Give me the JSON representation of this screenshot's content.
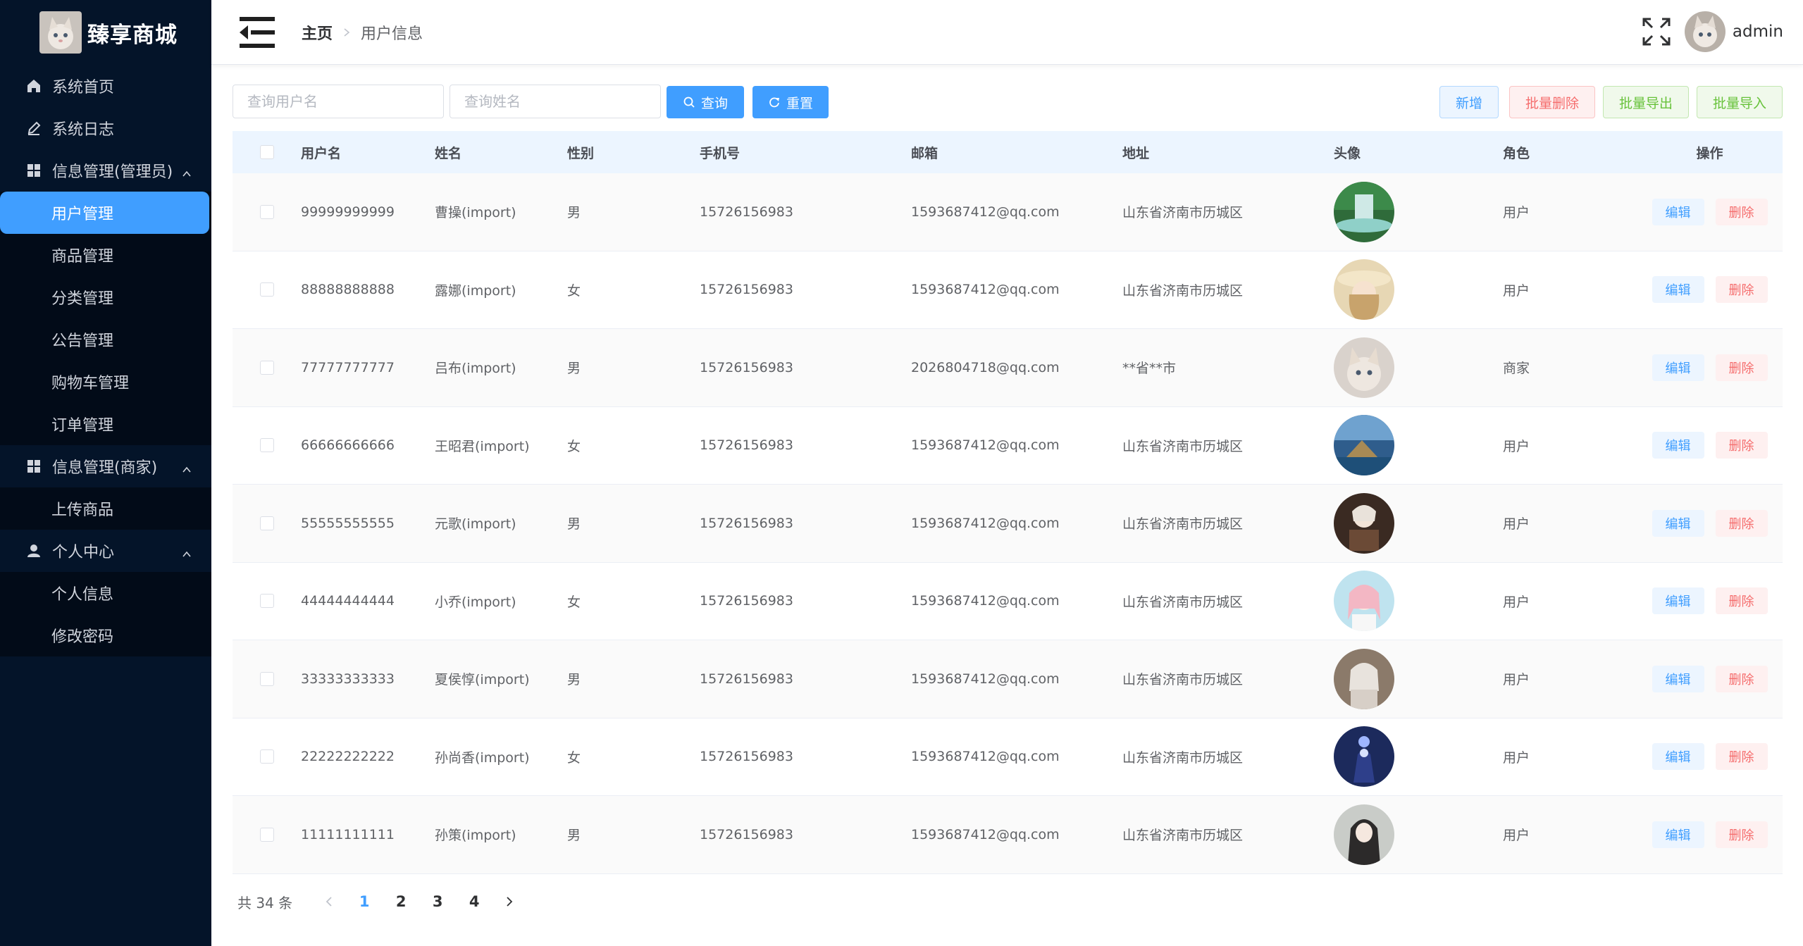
{
  "app": {
    "title": "臻享商城"
  },
  "sidebar": {
    "items": [
      {
        "label": "系统首页"
      },
      {
        "label": "系统日志"
      }
    ],
    "groups": [
      {
        "label": "信息管理(管理员)",
        "children": [
          "用户管理",
          "商品管理",
          "分类管理",
          "公告管理",
          "购物车管理",
          "订单管理"
        ]
      },
      {
        "label": "信息管理(商家)",
        "children": [
          "上传商品"
        ]
      },
      {
        "label": "个人中心",
        "children": [
          "个人信息",
          "修改密码"
        ]
      }
    ],
    "active": "用户管理"
  },
  "header": {
    "breadcrumb": {
      "home": "主页",
      "current": "用户信息"
    },
    "username": "admin"
  },
  "toolbar": {
    "username_placeholder": "查询用户名",
    "name_placeholder": "查询姓名",
    "search_label": "查询",
    "reset_label": "重置",
    "add_label": "新增",
    "batch_delete_label": "批量删除",
    "batch_export_label": "批量导出",
    "batch_import_label": "批量导入"
  },
  "table": {
    "columns": [
      "用户名",
      "姓名",
      "性别",
      "手机号",
      "邮箱",
      "地址",
      "头像",
      "角色",
      "操作"
    ],
    "edit_label": "编辑",
    "delete_label": "删除",
    "rows": [
      {
        "username": "99999999999",
        "name": "曹操(import)",
        "sex": "男",
        "phone": "15726156983",
        "email": "1593687412@qq.com",
        "address": "山东省济南市历城区",
        "role": "用户",
        "avatar": "waterfall"
      },
      {
        "username": "88888888888",
        "name": "露娜(import)",
        "sex": "女",
        "phone": "15726156983",
        "email": "1593687412@qq.com",
        "address": "山东省济南市历城区",
        "role": "用户",
        "avatar": "girl-hat"
      },
      {
        "username": "77777777777",
        "name": "吕布(import)",
        "sex": "男",
        "phone": "15726156983",
        "email": "2026804718@qq.com",
        "address": "**省**市",
        "role": "商家",
        "avatar": "cat"
      },
      {
        "username": "66666666666",
        "name": "王昭君(import)",
        "sex": "女",
        "phone": "15726156983",
        "email": "1593687412@qq.com",
        "address": "山东省济南市历城区",
        "role": "用户",
        "avatar": "lake-island"
      },
      {
        "username": "55555555555",
        "name": "元歌(import)",
        "sex": "男",
        "phone": "15726156983",
        "email": "1593687412@qq.com",
        "address": "山东省济南市历城区",
        "role": "用户",
        "avatar": "girl-reading"
      },
      {
        "username": "44444444444",
        "name": "小乔(import)",
        "sex": "女",
        "phone": "15726156983",
        "email": "1593687412@qq.com",
        "address": "山东省济南市历城区",
        "role": "用户",
        "avatar": "anime-girl"
      },
      {
        "username": "33333333333",
        "name": "夏侯惇(import)",
        "sex": "男",
        "phone": "15726156983",
        "email": "1593687412@qq.com",
        "address": "山东省济南市历城区",
        "role": "用户",
        "avatar": "girl-white"
      },
      {
        "username": "22222222222",
        "name": "孙尚香(import)",
        "sex": "女",
        "phone": "15726156983",
        "email": "1593687412@qq.com",
        "address": "山东省济南市历城区",
        "role": "用户",
        "avatar": "space-figure"
      },
      {
        "username": "11111111111",
        "name": "孙策(import)",
        "sex": "男",
        "phone": "15726156983",
        "email": "1593687412@qq.com",
        "address": "山东省济南市历城区",
        "role": "用户",
        "avatar": "girl-portrait"
      }
    ]
  },
  "pagination": {
    "total_text": "共 34 条",
    "pages": [
      "1",
      "2",
      "3",
      "4"
    ],
    "current": "1"
  },
  "colors": {
    "sidebar_bg": "#041429",
    "primary": "#409eff",
    "danger": "#f56c6c",
    "success": "#67c23a"
  }
}
